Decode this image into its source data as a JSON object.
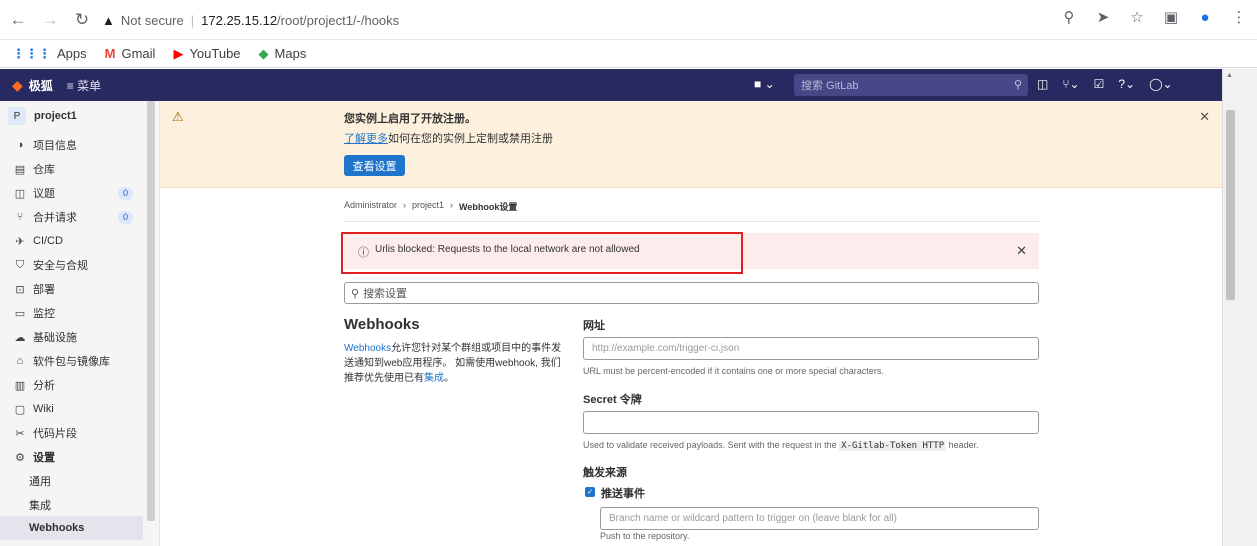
{
  "browser": {
    "security_label": "Not secure",
    "url_host": "172.25.15.12",
    "url_path": "/root/project1/-/hooks",
    "bookmarks": [
      {
        "label": "Apps",
        "icon": "apps-grid-icon",
        "color": "#1a73e8"
      },
      {
        "label": "Gmail",
        "icon": "gmail-icon",
        "color": "#ea4335"
      },
      {
        "label": "YouTube",
        "icon": "youtube-icon",
        "color": "#ff0000"
      },
      {
        "label": "Maps",
        "icon": "maps-icon",
        "color": "#34a853"
      }
    ]
  },
  "header": {
    "brand": "极狐",
    "menu": "菜单",
    "search_placeholder": "搜索 GitLab",
    "bg_color": "#292961"
  },
  "sidebar": {
    "project_initial": "P",
    "project_name": "project1",
    "items": [
      {
        "label": "项目信息",
        "icon": "info-icon"
      },
      {
        "label": "仓库",
        "icon": "repository-icon"
      },
      {
        "label": "议题",
        "icon": "issues-icon",
        "count": "0"
      },
      {
        "label": "合并请求",
        "icon": "merge-request-icon",
        "count": "0"
      },
      {
        "label": "CI/CD",
        "icon": "rocket-icon"
      },
      {
        "label": "安全与合规",
        "icon": "shield-icon"
      },
      {
        "label": "部署",
        "icon": "deploy-icon"
      },
      {
        "label": "监控",
        "icon": "monitor-icon"
      },
      {
        "label": "基础设施",
        "icon": "cloud-icon"
      },
      {
        "label": "软件包与镜像库",
        "icon": "package-icon"
      },
      {
        "label": "分析",
        "icon": "chart-icon"
      },
      {
        "label": "Wiki",
        "icon": "book-icon"
      },
      {
        "label": "代码片段",
        "icon": "snippet-icon"
      },
      {
        "label": "设置",
        "icon": "settings-icon"
      },
      {
        "label": "通用"
      },
      {
        "label": "集成"
      },
      {
        "label": "Webhooks"
      }
    ]
  },
  "banner": {
    "title": "您实例上启用了开放注册。",
    "link": "了解更多",
    "text": "如何在您的实例上定制或禁用注册",
    "button": "查看设置"
  },
  "breadcrumb": [
    "Administrator",
    "project1",
    "Webhook设置"
  ],
  "alert": {
    "message": "Urlis blocked: Requests to the local network are not allowed"
  },
  "search_settings_placeholder": "搜索设置",
  "webhooks": {
    "title": "Webhooks",
    "desc_link": "Webhooks",
    "desc_text1": "允许您针对某个群组或项目中的事件发送通知到web应用程序。 如需使用webhook, 我们推荐优先使用已有",
    "desc_link2": "集成",
    "desc_end": "。"
  },
  "form": {
    "url_label": "网址",
    "url_placeholder": "http://example.com/trigger-ci.json",
    "url_help": "URL must be percent-encoded if it contains one or more special characters.",
    "secret_label": "Secret 令牌",
    "secret_help_before": "Used to validate received payloads. Sent with the request in the",
    "secret_help_code": "X-Gitlab-Token HTTP",
    "secret_help_after": "header.",
    "trigger_label": "触发来源",
    "push_label": "推送事件",
    "push_checked": true,
    "branch_placeholder": "Branch name or wildcard pattern to trigger on (leave blank for all)",
    "push_help": "Push to the repository."
  }
}
